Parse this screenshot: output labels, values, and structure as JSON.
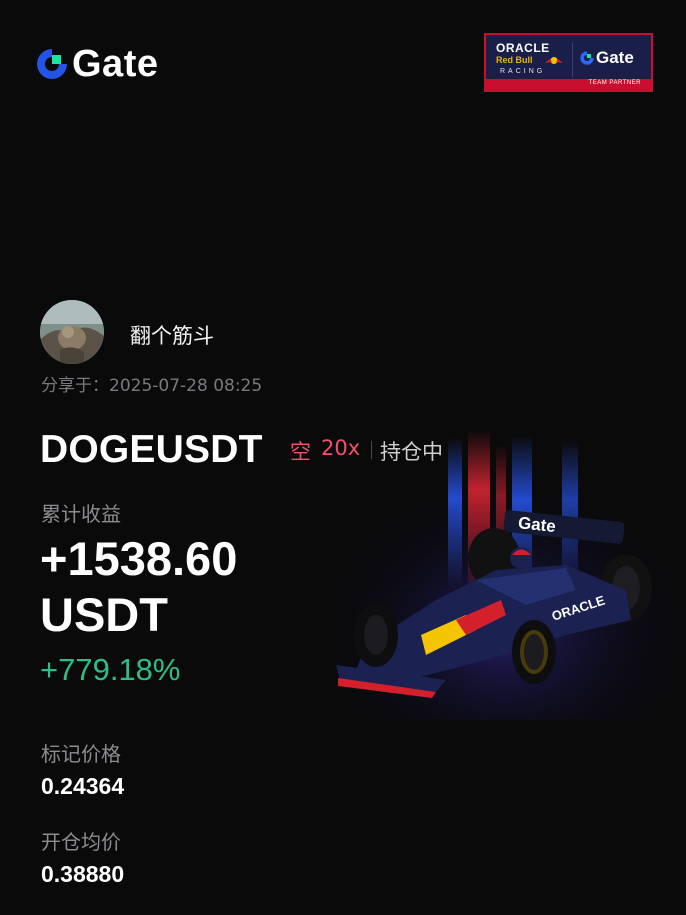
{
  "brand": {
    "name": "Gate",
    "color": "#2354e6",
    "accent": "#17e6a1"
  },
  "partner_badge": {
    "line1": "ORACLE",
    "line2": "Red Bull",
    "line3": "RACING",
    "brand": "Gate",
    "footer": "TEAM PARTNER"
  },
  "user": {
    "name": "翻个筋斗",
    "shared_label": "分享于：",
    "shared_time": "2025-07-28 08:25"
  },
  "position": {
    "pair": "DOGEUSDT",
    "side": "空",
    "leverage": "20x",
    "status": "持仓中",
    "pnl_label": "累计收益",
    "pnl_value": "+1538.60",
    "pnl_unit": "USDT",
    "roi": "+779.18%",
    "mark_price_label": "标记价格",
    "mark_price": "0.24364",
    "entry_price_label": "开仓均价",
    "entry_price": "0.38880"
  },
  "colors": {
    "short": "#f0506e",
    "profit": "#2ebd85",
    "muted": "#8c8c90"
  },
  "icons": [
    "gate-logo-icon",
    "red-bull-icon",
    "f1-car-illustration",
    "avatar"
  ]
}
